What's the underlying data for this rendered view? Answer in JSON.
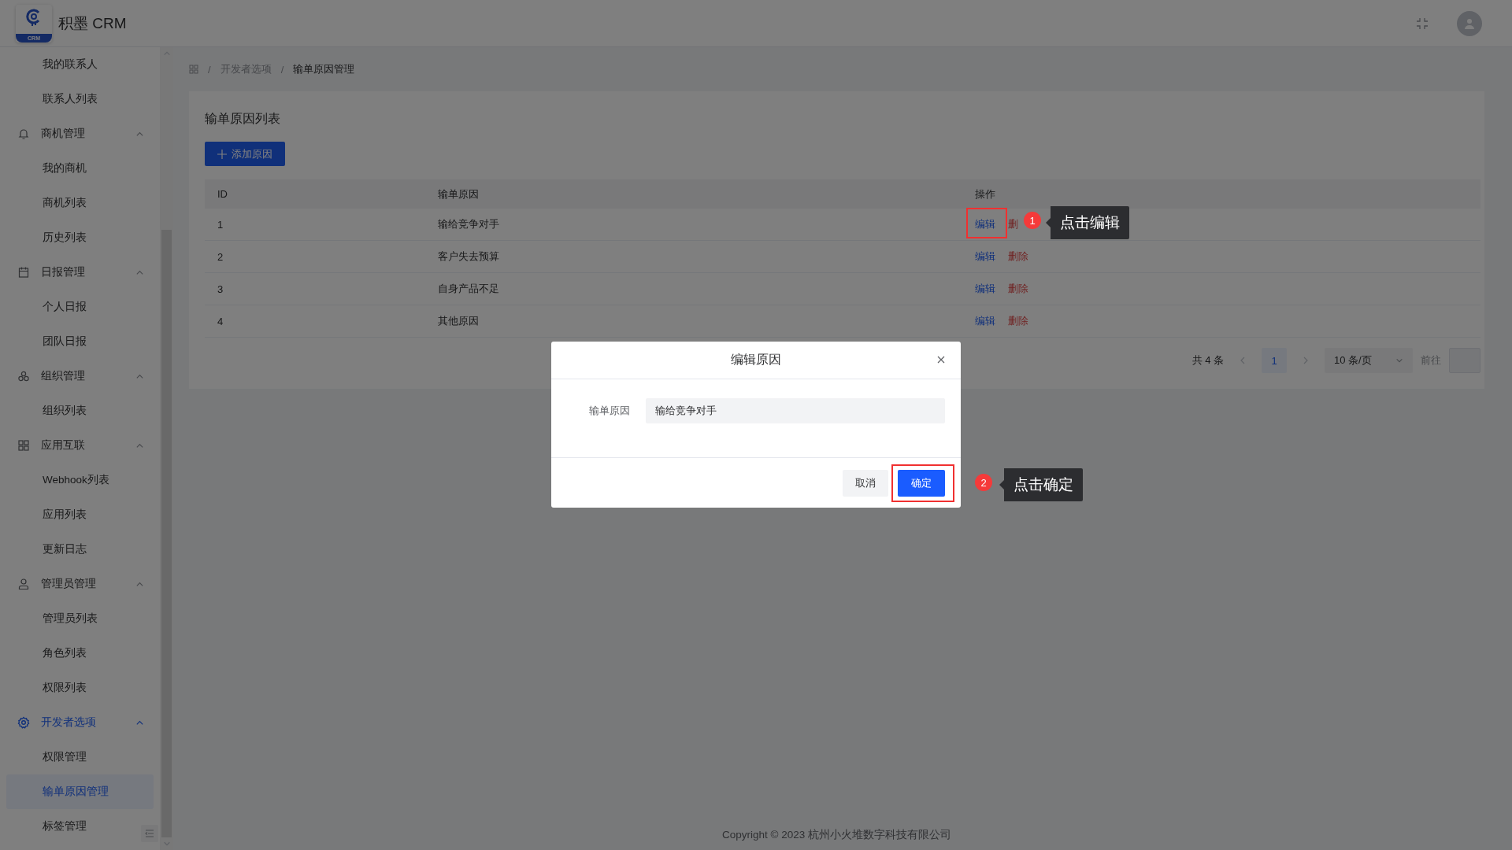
{
  "header": {
    "brand": "积墨 CRM",
    "logo_text": "CRM"
  },
  "sidebar": {
    "groups": [
      {
        "children": [
          {
            "label": "我的联系人",
            "selected": false
          },
          {
            "label": "联系人列表",
            "selected": false
          }
        ]
      },
      {
        "label": "商机管理",
        "expanded": true,
        "selected": false,
        "children": [
          {
            "label": "我的商机",
            "selected": false
          },
          {
            "label": "商机列表",
            "selected": false
          },
          {
            "label": "历史列表",
            "selected": false
          }
        ]
      },
      {
        "label": "日报管理",
        "expanded": true,
        "selected": false,
        "children": [
          {
            "label": "个人日报",
            "selected": false
          },
          {
            "label": "团队日报",
            "selected": false
          }
        ]
      },
      {
        "label": "组织管理",
        "expanded": true,
        "selected": false,
        "children": [
          {
            "label": "组织列表",
            "selected": false
          }
        ]
      },
      {
        "label": "应用互联",
        "expanded": true,
        "selected": false,
        "children": [
          {
            "label": "Webhook列表",
            "selected": false
          },
          {
            "label": "应用列表",
            "selected": false
          },
          {
            "label": "更新日志",
            "selected": false
          }
        ]
      },
      {
        "label": "管理员管理",
        "expanded": true,
        "selected": false,
        "children": [
          {
            "label": "管理员列表",
            "selected": false
          },
          {
            "label": "角色列表",
            "selected": false
          },
          {
            "label": "权限列表",
            "selected": false
          }
        ]
      },
      {
        "label": "开发者选项",
        "expanded": true,
        "selected": true,
        "children": [
          {
            "label": "权限管理",
            "selected": false
          },
          {
            "label": "输单原因管理",
            "selected": true
          },
          {
            "label": "标签管理",
            "selected": false
          }
        ]
      }
    ]
  },
  "breadcrumb": {
    "separator": "/",
    "items": [
      "开发者选项",
      "输单原因管理"
    ]
  },
  "card": {
    "title": "输单原因列表",
    "add_button": "添加原因"
  },
  "table": {
    "columns": [
      "ID",
      "输单原因",
      "操作"
    ],
    "rows": [
      {
        "id": "1",
        "reason": "输给竞争对手",
        "edit": "编辑",
        "delete": "删"
      },
      {
        "id": "2",
        "reason": "客户失去预算",
        "edit": "编辑",
        "delete": "删除"
      },
      {
        "id": "3",
        "reason": "自身产品不足",
        "edit": "编辑",
        "delete": "删除"
      },
      {
        "id": "4",
        "reason": "其他原因",
        "edit": "编辑",
        "delete": "删除"
      }
    ]
  },
  "pagination": {
    "total": "共 4 条",
    "pages": [
      {
        "label": "1",
        "selected": true
      }
    ],
    "page_size": "10 条/页",
    "goto": "前往"
  },
  "footer": "Copyright © 2023 杭州小火堆数字科技有限公司",
  "dialog": {
    "title": "编辑原因",
    "field_label": "输单原因",
    "field_value": "输给竞争对手",
    "cancel": "取消",
    "confirm": "确定"
  },
  "annotations": [
    {
      "number": "1",
      "text": "点击编辑"
    },
    {
      "number": "2",
      "text": "点击确定"
    }
  ]
}
